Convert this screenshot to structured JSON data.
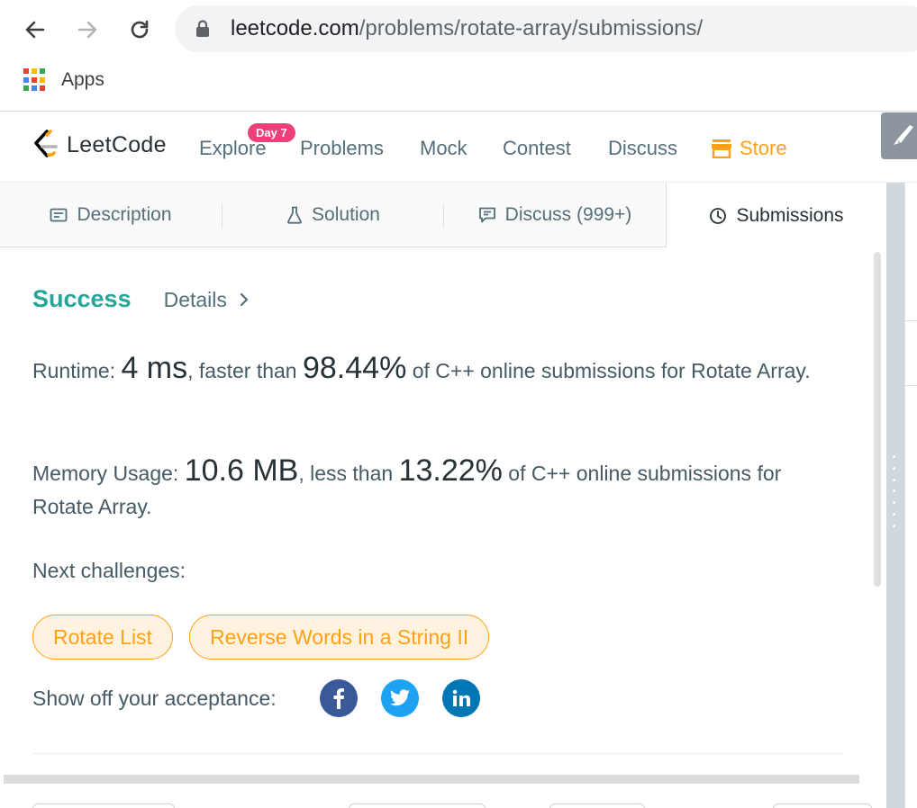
{
  "browser": {
    "url_domain": "leetcode.com",
    "url_path": "/problems/rotate-array/submissions/",
    "bookmarks": [
      {
        "label": "Apps",
        "icon": "apps-grid-icon"
      }
    ]
  },
  "header": {
    "logo_text": "LeetCode",
    "badge": "Day 7",
    "nav": {
      "explore": "Explore",
      "problems": "Problems",
      "mock": "Mock",
      "contest": "Contest",
      "discuss": "Discuss",
      "store": "Store"
    },
    "colors": {
      "accent": "#ffa116",
      "badge": "#ec407a"
    }
  },
  "tabs": {
    "description": "Description",
    "solution": "Solution",
    "discuss": "Discuss (999+)",
    "submissions": "Submissions",
    "active": "Submissions"
  },
  "result": {
    "status": "Success",
    "details": "Details",
    "runtime_label": "Runtime:",
    "runtime_value": "4 ms",
    "runtime_mid": ", faster than",
    "runtime_pct": "98.44%",
    "runtime_tail": "of C++ online submissions for Rotate Array.",
    "memory_label": "Memory Usage:",
    "memory_value": "10.6 MB",
    "memory_mid": ", less than",
    "memory_pct": "13.22%",
    "memory_tail": "of C++ online submissions for Rotate Array.",
    "status_color": "#26a69a"
  },
  "next_challenges": {
    "label": "Next challenges:",
    "items": [
      "Rotate List",
      "Reverse Words in a String II"
    ]
  },
  "share": {
    "label": "Show off your acceptance:",
    "networks": [
      "facebook-icon",
      "twitter-icon",
      "linkedin-icon"
    ]
  }
}
